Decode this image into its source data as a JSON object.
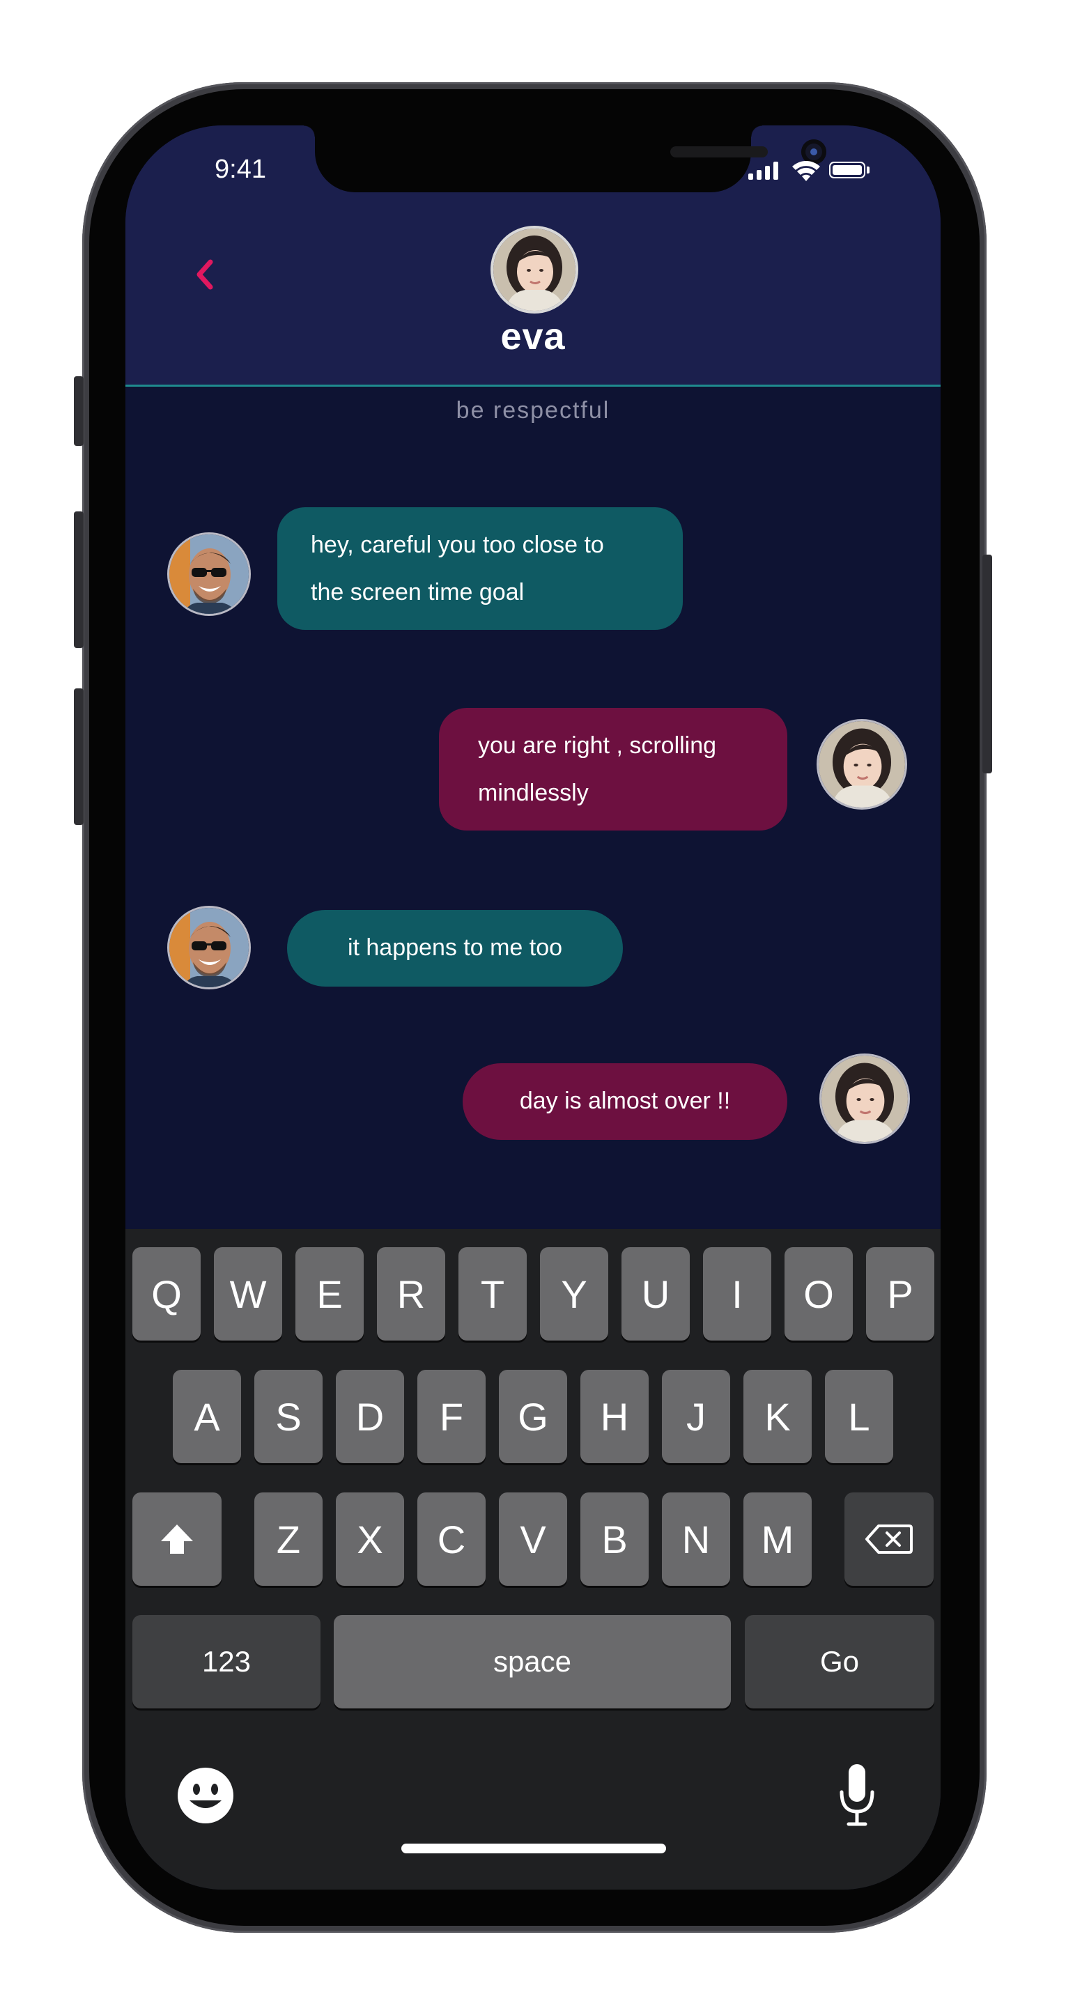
{
  "status_bar": {
    "time": "9:41"
  },
  "header": {
    "name": "eva"
  },
  "banner": "be respectful",
  "messages": [
    {
      "sender": "other",
      "lines": [
        "hey, careful you too close to",
        "the screen time goal"
      ]
    },
    {
      "sender": "me",
      "lines": [
        "you are right , scrolling",
        "mindlessly"
      ]
    },
    {
      "sender": "other",
      "lines": [
        "it happens to me too"
      ]
    },
    {
      "sender": "me",
      "lines": [
        "day is almost over !!"
      ]
    }
  ],
  "keyboard": {
    "row1": [
      "Q",
      "W",
      "E",
      "R",
      "T",
      "Y",
      "U",
      "I",
      "O",
      "P"
    ],
    "row2": [
      "A",
      "S",
      "D",
      "F",
      "G",
      "H",
      "J",
      "K",
      "L"
    ],
    "row3": [
      "Z",
      "X",
      "C",
      "V",
      "B",
      "N",
      "M"
    ],
    "numbers_label": "123",
    "space_label": "space",
    "go_label": "Go"
  },
  "colors": {
    "header": "#1b1f4d",
    "background": "#0e1333",
    "incoming_bubble": "#0f5a63",
    "outgoing_bubble": "#6d1040",
    "accent": "#e0185f"
  }
}
